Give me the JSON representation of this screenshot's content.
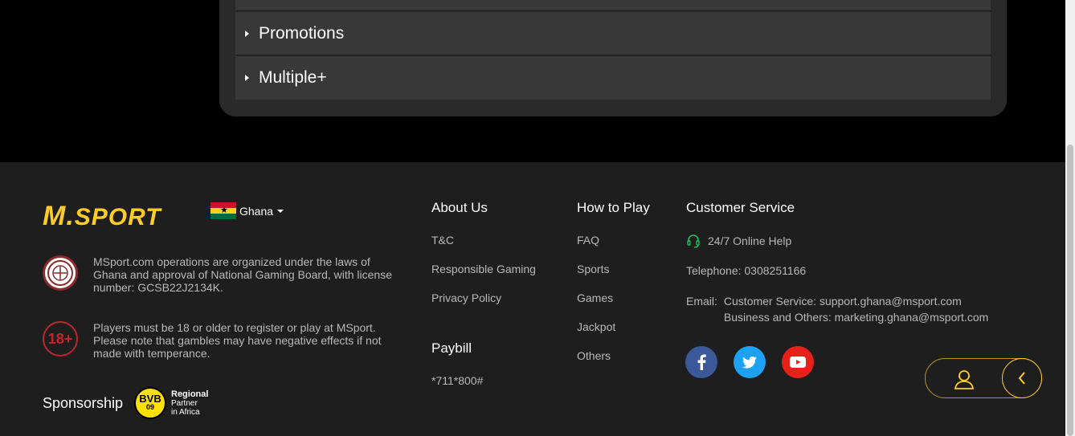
{
  "accordion": {
    "items": [
      {
        "label": "Promotions"
      },
      {
        "label": "Multiple+"
      }
    ]
  },
  "footer": {
    "logo_text": "SPORT",
    "logo_m": "M.",
    "country": "Ghana",
    "license_notice": "MSport.com operations are organized under the laws of Ghana and approval of National Gaming Board, with license number: GCSB22J2134K.",
    "age_badge": "18+",
    "age_notice": "Players must be 18 or older to register or play at MSport. Please note that gambles may have negative effects if not made with temperance.",
    "sponsorship_label": "Sponsorship",
    "bvb_text": "BVB",
    "bvb_number": "09",
    "sponsor_line1": "Regional",
    "sponsor_line2": "Partner",
    "sponsor_line3": "in Africa",
    "about": {
      "title": "About Us",
      "links": [
        "T&C",
        "Responsible Gaming",
        "Privacy Policy"
      ]
    },
    "paybill": {
      "title": "Paybill",
      "code": "*711*800#"
    },
    "how_to_play": {
      "title": "How to Play",
      "links": [
        "FAQ",
        "Sports",
        "Games",
        "Jackpot",
        "Others"
      ]
    },
    "customer_service": {
      "title": "Customer Service",
      "online_help": "24/7 Online Help",
      "telephone": "Telephone: 0308251166",
      "email_label": "Email:",
      "email_cs": "Customer Service: support.ghana@msport.com",
      "email_business": "Business and Others: marketing.ghana@msport.com"
    },
    "socials": [
      "facebook-icon",
      "twitter-icon",
      "youtube-icon"
    ]
  },
  "colors": {
    "brand": "#ffcc2a",
    "background": "#1e1e1e",
    "panel": "#383838"
  }
}
